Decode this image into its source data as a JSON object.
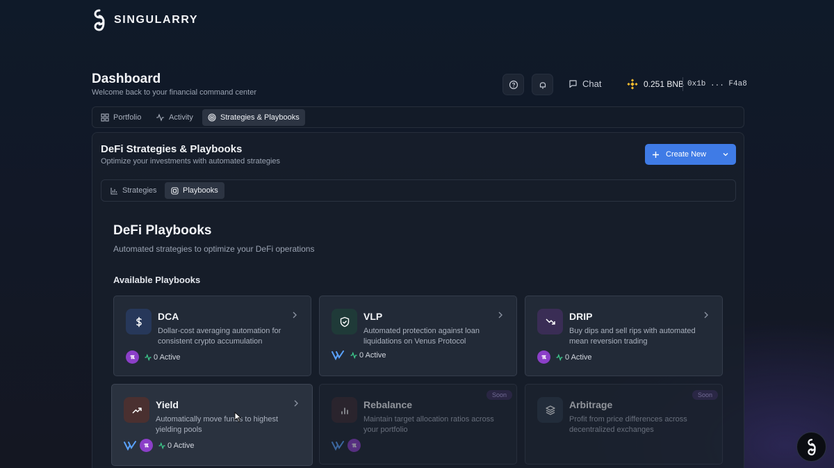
{
  "brand": {
    "name": "SINGULARRY"
  },
  "header": {
    "title": "Dashboard",
    "subtitle": "Welcome back to your financial command center",
    "chat_label": "Chat",
    "balance": "0.251 BNB",
    "address": "0x1b ... F4a8"
  },
  "main_tabs": [
    {
      "label": "Portfolio"
    },
    {
      "label": "Activity"
    },
    {
      "label": "Strategies & Playbooks",
      "active": true
    }
  ],
  "panel": {
    "title": "DeFi Strategies & Playbooks",
    "subtitle": "Optimize your investments with automated strategies",
    "create_label": "Create New",
    "sub_tabs": [
      {
        "label": "Strategies"
      },
      {
        "label": "Playbooks",
        "active": true
      }
    ]
  },
  "playbooks": {
    "title": "DeFi Playbooks",
    "subtitle": "Automated strategies to optimize your DeFi operations",
    "section_label": "Available Playbooks",
    "cards": [
      {
        "name": "DCA",
        "desc": "Dollar-cost averaging automation for consistent crypto accumulation",
        "active": "0 Active",
        "icon": "dollar-icon",
        "color": "#27385a"
      },
      {
        "name": "VLP",
        "desc": "Automated protection against loan liquidations on Venus Protocol",
        "active": "0 Active",
        "icon": "shield-icon",
        "color": "#1f3a38"
      },
      {
        "name": "DRIP",
        "desc": "Buy dips and sell rips with automated mean reversion trading",
        "active": "0 Active",
        "icon": "trend-down-icon",
        "color": "#3a2d55"
      },
      {
        "name": "Yield",
        "desc": "Automatically move funds to highest yielding pools",
        "active": "0 Active",
        "icon": "trend-up-icon",
        "color": "#4a3030"
      },
      {
        "name": "Rebalance",
        "desc": "Maintain target allocation ratios across your portfolio",
        "badge": "Soon",
        "icon": "bar-chart-icon",
        "color": "#3a2b32"
      },
      {
        "name": "Arbitrage",
        "desc": "Profit from price differences across decentralized exchanges",
        "badge": "Soon",
        "icon": "layers-icon",
        "color": "#2b3a48"
      }
    ]
  },
  "colors": {
    "accent": "#3f7be6",
    "background": "#121827",
    "card": "#222a37",
    "active_green": "#3ecf8e"
  }
}
